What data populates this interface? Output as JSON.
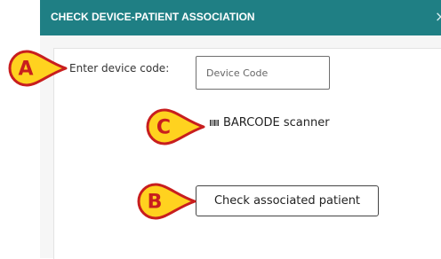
{
  "dialog": {
    "title": "CHECK DEVICE-PATIENT ASSOCIATION",
    "close_symbol": "×"
  },
  "form": {
    "device_code_label": "Enter device code:",
    "device_code_placeholder": "Device Code",
    "device_code_value": "",
    "scanner_icon": "barcode-icon",
    "scanner_label": "BARCODE scanner",
    "check_button_label": "Check associated patient"
  },
  "callouts": {
    "a": "A",
    "b": "B",
    "c": "C"
  },
  "colors": {
    "header_bg": "#1f7f84",
    "callout_fill": "#ffd21f",
    "callout_border": "#c81e1e",
    "callout_text": "#c81e1e"
  }
}
